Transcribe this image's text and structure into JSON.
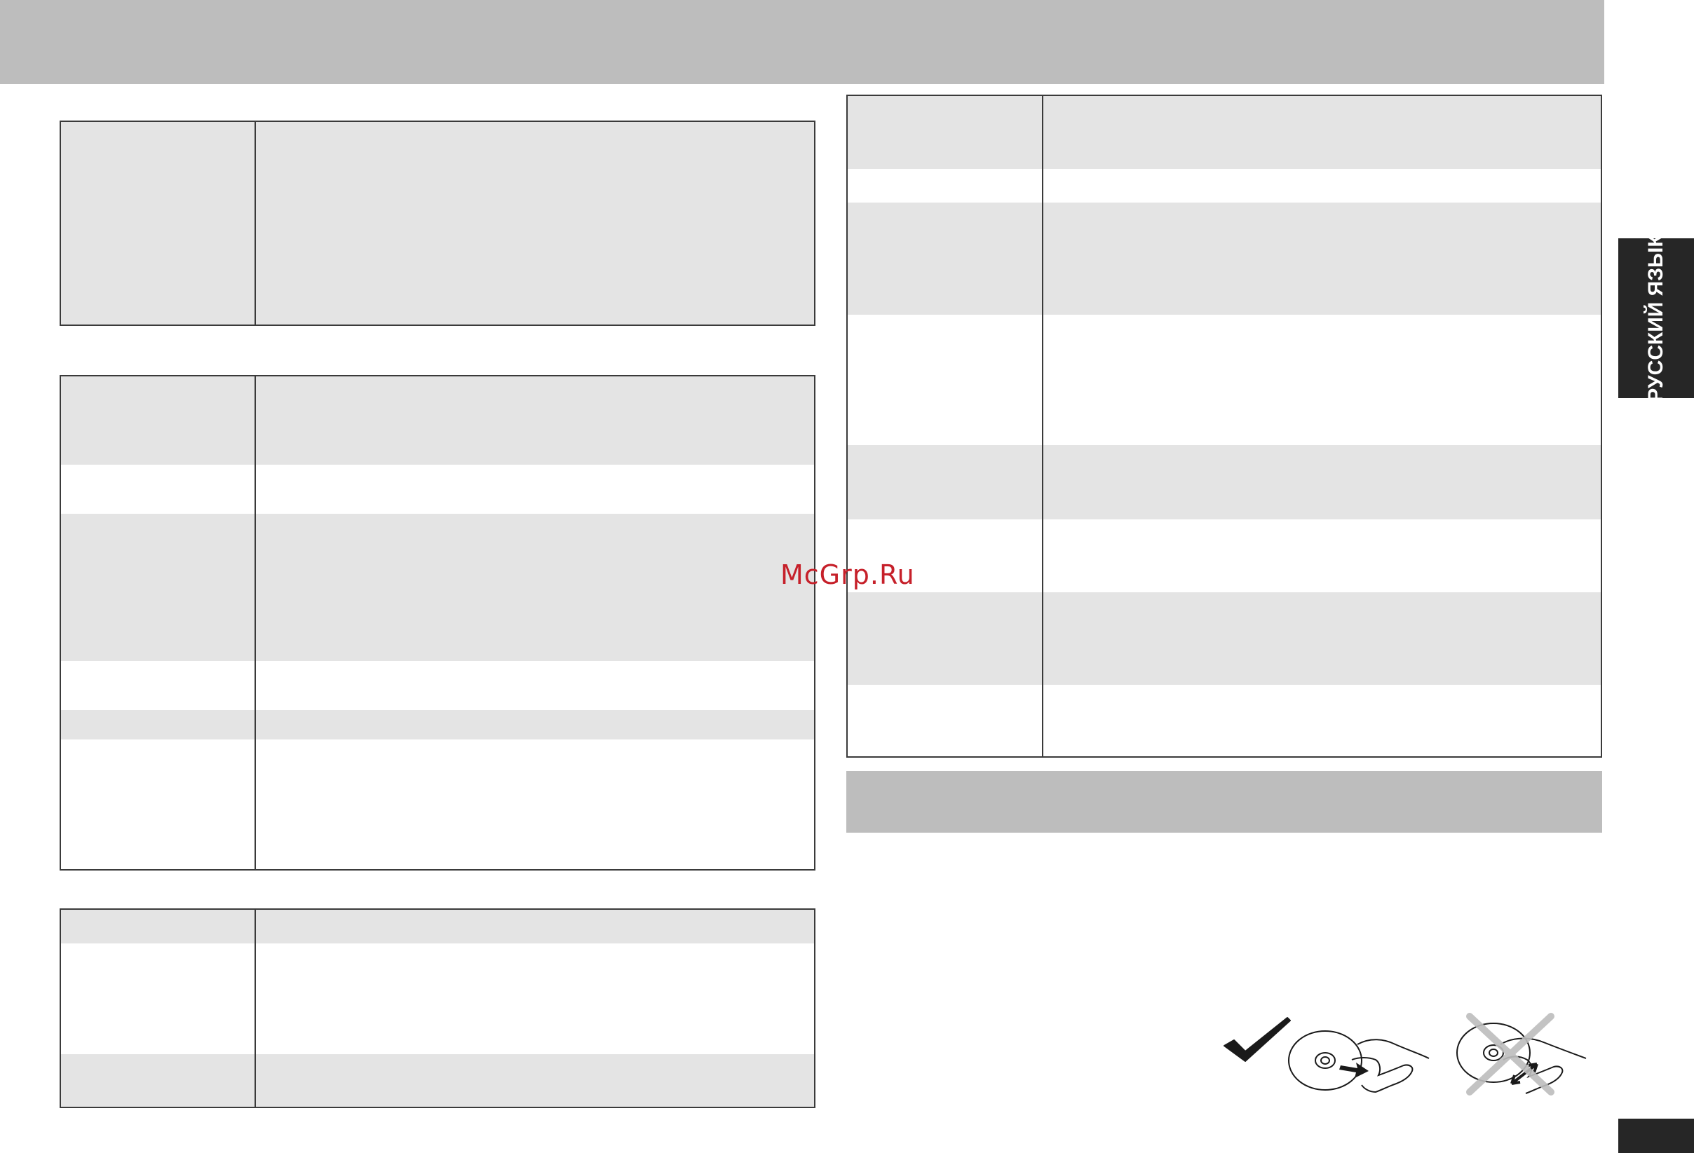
{
  "page": {
    "language_tab": "РУССКИЙ ЯЗЫК",
    "watermark": "McGrp.Ru"
  },
  "colors": {
    "header_band": "#bdbdbd",
    "row_shade": "#e4e4e4",
    "table_border": "#3a3a3a",
    "tab_background": "#262626",
    "watermark": "#c6202a"
  },
  "illustration": {
    "icons": [
      "checkmark-icon",
      "disc-icon",
      "hand-icon",
      "arrow-icon",
      "cross-icon"
    ]
  }
}
